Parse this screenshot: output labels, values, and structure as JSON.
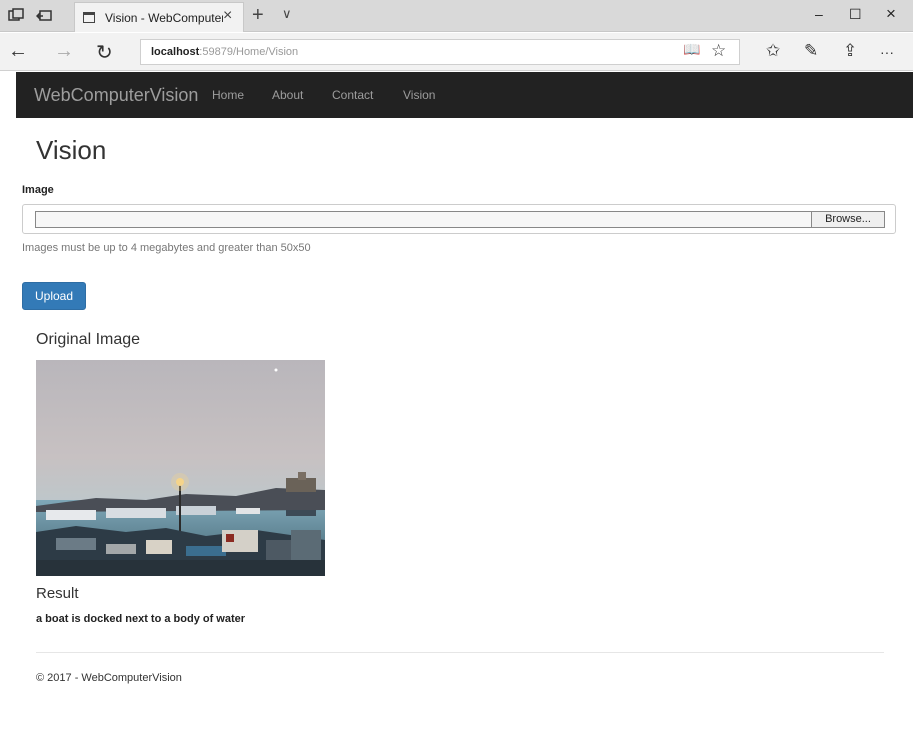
{
  "browser": {
    "tab_title": "Vision - WebComputer\\",
    "tab_close": "×",
    "new_tab": "+",
    "tab_list": "∨",
    "url_host": "localhost",
    "url_rest": ":59879/Home/Vision",
    "back": "←",
    "forward": "→",
    "refresh": "↻",
    "window_min": "–",
    "window_max": "☐",
    "window_close": "×",
    "tools": {
      "reading_view": "📖",
      "favorite": "☆",
      "favorites_hub": "✩",
      "notes": "✎",
      "share": "⇪",
      "more": "···"
    }
  },
  "navbar": {
    "brand": "WebComputerVision",
    "links": [
      "Home",
      "About",
      "Contact",
      "Vision"
    ]
  },
  "page": {
    "title": "Vision",
    "image_label": "Image",
    "browse_label": "Browse...",
    "help_text": "Images must be up to 4 megabytes and greater than 50x50",
    "upload_label": "Upload",
    "original_heading": "Original Image",
    "result_heading": "Result",
    "result_text": "a boat is docked next to a body of water"
  },
  "footer": {
    "text": "© 2017 - WebComputerVision"
  },
  "colors": {
    "navbar_bg": "#222222",
    "nav_text": "#9d9d9d",
    "primary_button": "#337ab7"
  }
}
